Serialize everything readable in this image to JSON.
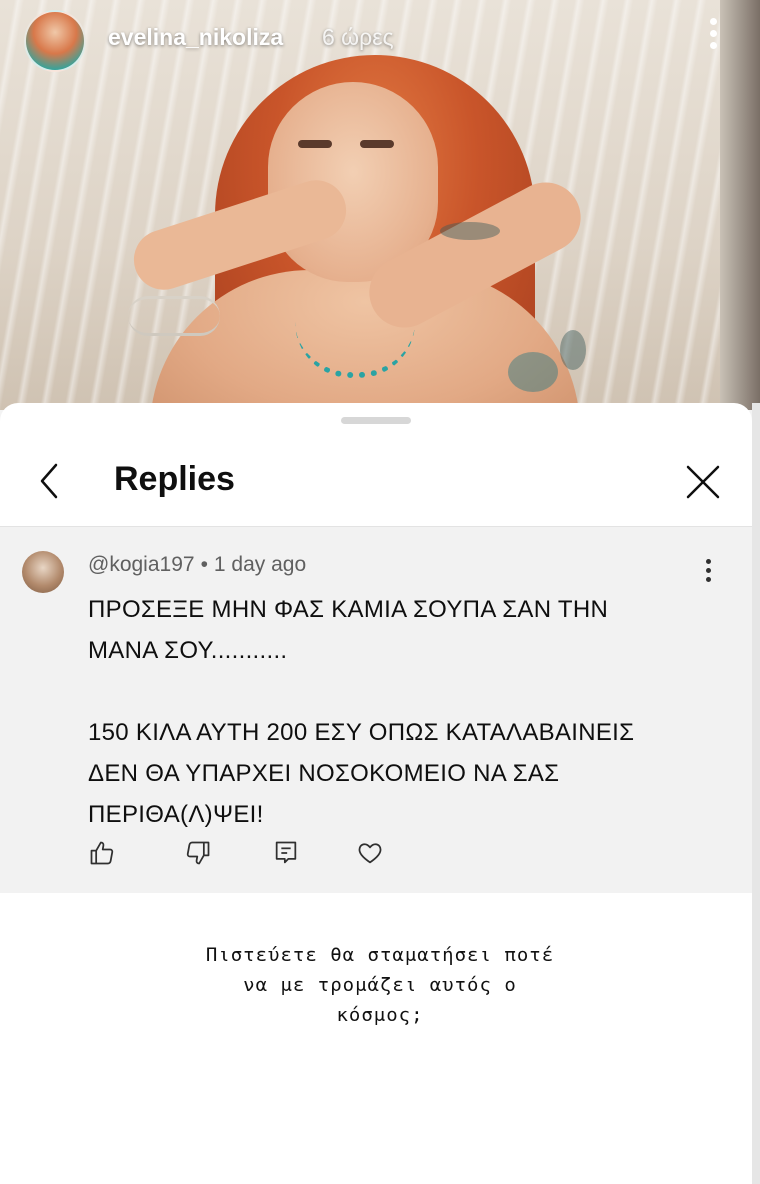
{
  "story": {
    "username": "evelina_nikoliza",
    "time": "6 ώρες",
    "menu_icon": "more-vertical-icon",
    "photo_description_icon": "story-photo"
  },
  "sheet": {
    "title": "Replies",
    "back_icon": "chevron-left-icon",
    "close_icon": "close-icon"
  },
  "comment": {
    "author": "@kogia197",
    "separator": "•",
    "age": "1 day ago",
    "text": "ΠΡΟΣΕΞΕ  ΜΗΝ ΦΑΣ  ΚΑΜΙΑ  ΣΟΥΠΑ  ΣΑΝ ΤΗΝ\nΜΑΝΑ ΣΟΥ...........\n\n150 ΚΙΛΑ ΑΥΤΗ  200  ΕΣΥ  ΟΠΩΣ ΚΑΤΑΛΑΒΑΙΝΕΙΣ\nΔΕΝ ΘΑ ΥΠΑΡΧΕΙ ΝΟΣΟΚΟΜΕΙΟ ΝΑ ΣΑΣ\nΠΕΡΙΘΑ(Λ)ΨΕΙ!",
    "actions": [
      "thumbs-up-icon",
      "thumbs-down-icon",
      "reply-icon",
      "heart-icon"
    ]
  },
  "caption": "Πιστεύετε θα σταματήσει ποτέ\nνα με τρομάζει αυτός ο\nκόσμος;"
}
